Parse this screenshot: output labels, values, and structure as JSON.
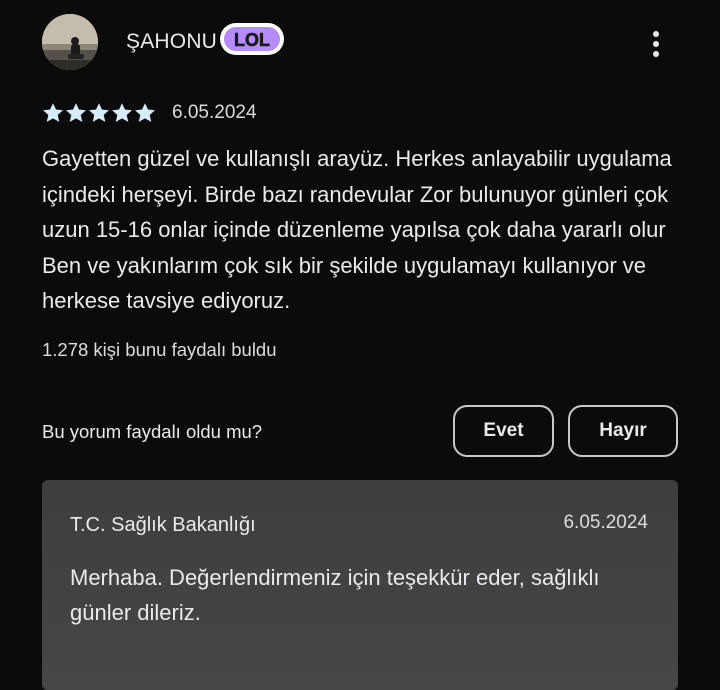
{
  "review": {
    "author": "ŞAHONU",
    "sticker_text": "LOL",
    "rating": 5,
    "max_rating": 5,
    "date": "6.05.2024",
    "text": "Gayetten güzel ve kullanışlı arayüz. Herkes anlayabilir uygulama içindeki herşeyi. Birde bazı randevular Zor bulunuyor günleri çok uzun 15-16 onlar içinde düzenleme yapılsa çok daha yararlı olur Ben ve yakınlarım çok sık bir şekilde uygulamayı kullanıyor ve herkese tavsiye ediyoruz.",
    "helpful_count": "1.278 kişi bunu faydalı buldu"
  },
  "feedback": {
    "question": "Bu yorum faydalı oldu mu?",
    "yes_label": "Evet",
    "no_label": "Hayır"
  },
  "developer_reply": {
    "author": "T.C. Sağlık Bakanlığı",
    "date": "6.05.2024",
    "text": "Merhaba. Değerlendirmeniz için teşekkür eder, sağlıklı günler dileriz."
  },
  "colors": {
    "background": "#0b0b0b",
    "text": "#e8eaed",
    "star": "#d6ecff",
    "reply_background": "#424242",
    "sticker_fill": "#b48cff"
  },
  "icons": {
    "avatar": "profile-photo",
    "menu": "more-vert-icon",
    "star": "star-icon"
  }
}
